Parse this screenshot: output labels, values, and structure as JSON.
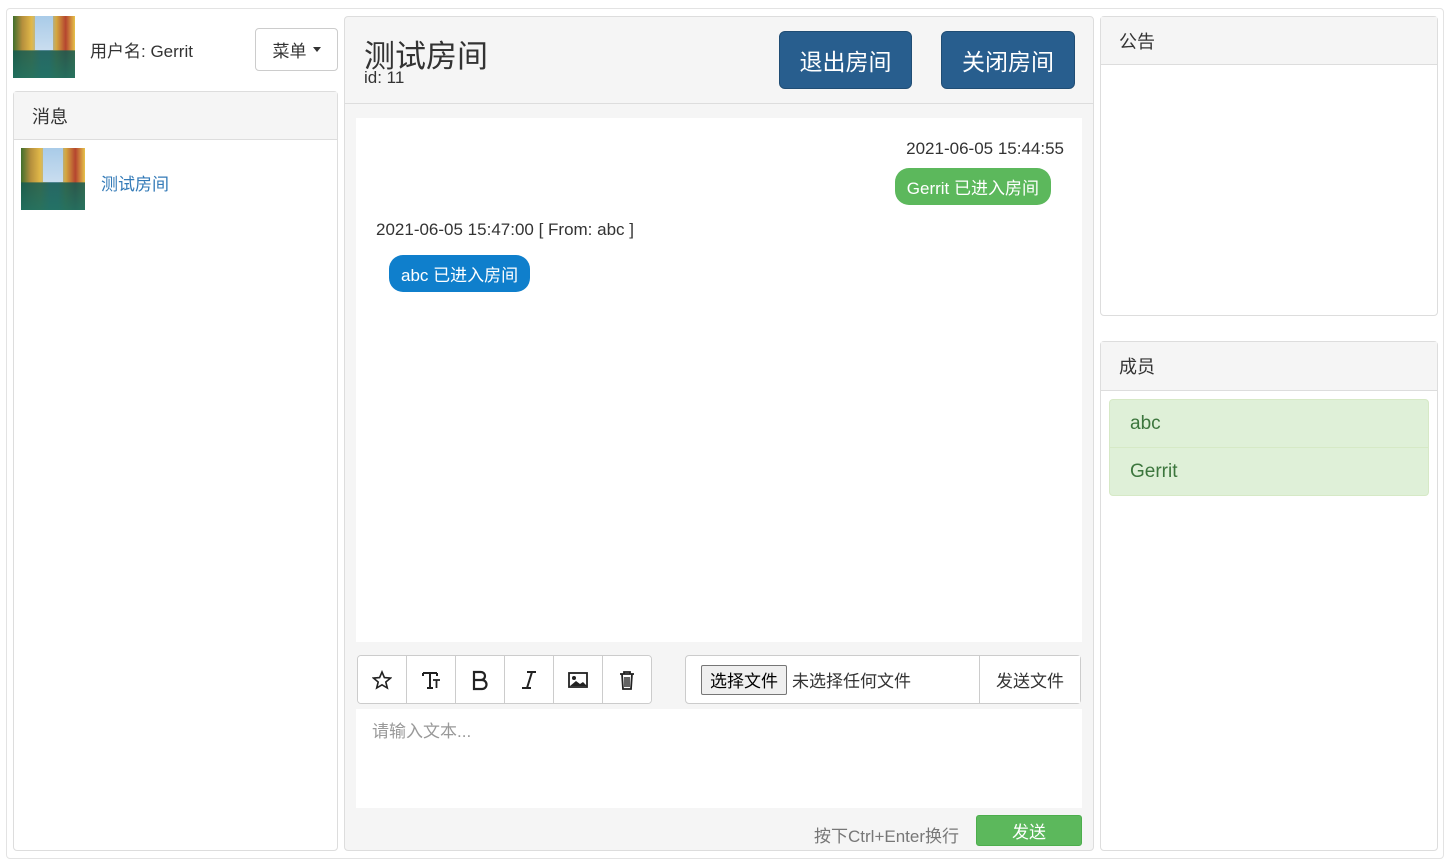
{
  "user": {
    "username_label": "用户名: Gerrit"
  },
  "menu": {
    "label": "菜单"
  },
  "messages_panel": {
    "title": "消息",
    "rooms": [
      {
        "name": "测试房间"
      }
    ]
  },
  "room": {
    "title": "测试房间",
    "id_label": "id: 11",
    "exit_label": "退出房间",
    "close_label": "关闭房间"
  },
  "chat": {
    "messages": [
      {
        "timestamp": "2021-06-05 15:44:55",
        "text": "Gerrit 已进入房间",
        "side": "right",
        "color": "#5cb85c"
      },
      {
        "timestamp": "2021-06-05 15:47:00 [ From: abc ]",
        "text": "abc 已进入房间",
        "side": "left",
        "color": "#0f7fcc"
      }
    ]
  },
  "toolbar": {
    "tools": [
      "star-icon",
      "text-size-icon",
      "bold-icon",
      "italic-icon",
      "image-icon",
      "trash-icon"
    ]
  },
  "file_upload": {
    "choose_label": "选择文件",
    "no_file_label": "未选择任何文件",
    "send_file_label": "发送文件"
  },
  "composer": {
    "placeholder": "请输入文本...",
    "hint": "按下Ctrl+Enter换行",
    "send_label": "发送"
  },
  "notice_panel": {
    "title": "公告"
  },
  "members_panel": {
    "title": "成员",
    "members": [
      "abc",
      "Gerrit"
    ]
  },
  "colors": {
    "primary_dark": "#285e8e",
    "success": "#5cb85c",
    "info_blue": "#0f7fcc",
    "link": "#337ab7",
    "member_bg": "#dff0d8"
  }
}
